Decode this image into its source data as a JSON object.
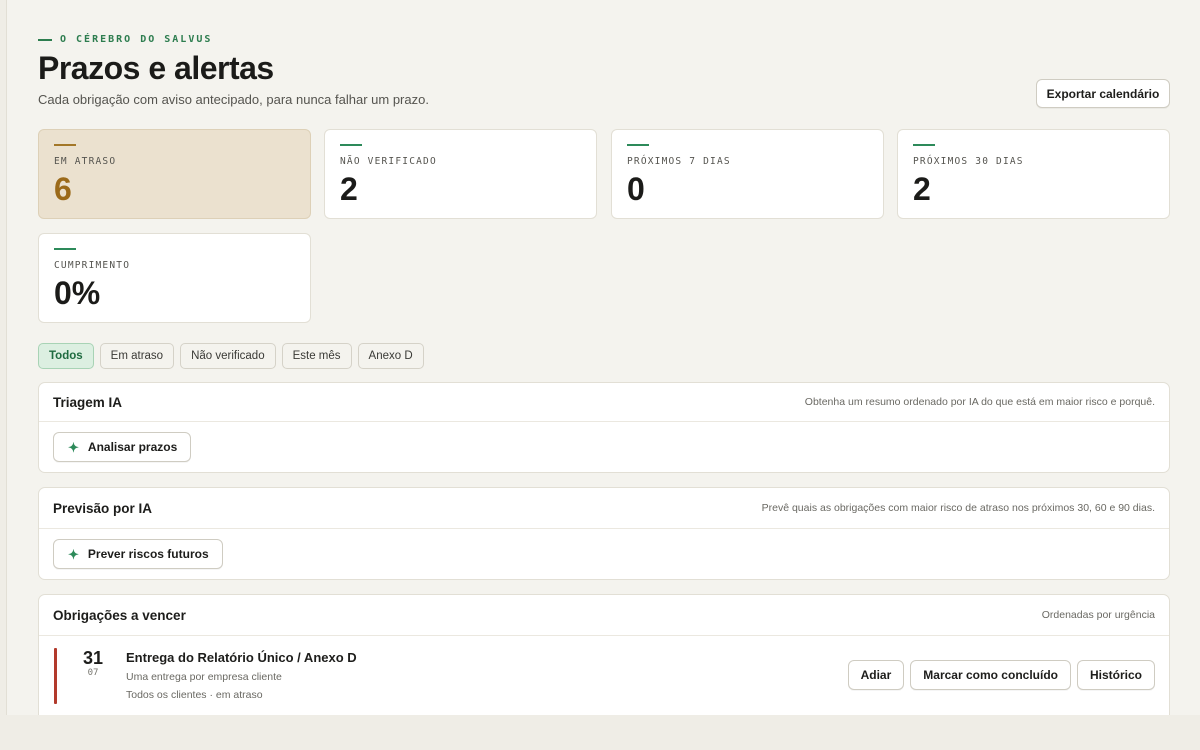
{
  "header": {
    "eyebrow": "O CÉREBRO DO SALVUS",
    "title": "Prazos e alertas",
    "subtitle": "Cada obrigação com aviso antecipado, para nunca falhar um prazo.",
    "export_label": "Exportar calendário"
  },
  "stats": [
    {
      "label": "EM ATRASO",
      "value": "6"
    },
    {
      "label": "NÃO VERIFICADO",
      "value": "2"
    },
    {
      "label": "PRÓXIMOS 7 DIAS",
      "value": "0"
    },
    {
      "label": "PRÓXIMOS 30 DIAS",
      "value": "2"
    },
    {
      "label": "CUMPRIMENTO",
      "value": "0%"
    }
  ],
  "filters": [
    "Todos",
    "Em atraso",
    "Não verificado",
    "Este mês",
    "Anexo D"
  ],
  "triage": {
    "title": "Triagem IA",
    "desc": "Obtenha um resumo ordenado por IA do que está em maior risco e porquê.",
    "button": "Analisar prazos"
  },
  "forecast": {
    "title": "Previsão por IA",
    "desc": "Prevê quais as obrigações com maior risco de atraso nos próximos 30, 60 e 90 dias.",
    "button": "Prever riscos futuros"
  },
  "obligations": {
    "title": "Obrigações a vencer",
    "desc": "Ordenadas por urgência",
    "items": [
      {
        "day": "31",
        "month": "07",
        "title": "Entrega do Relatório Único / Anexo D",
        "subtitle": "Uma entrega por empresa cliente",
        "meta": "Todos os clientes · em atraso",
        "actions": {
          "postpone": "Adiar",
          "complete": "Marcar como concluído",
          "history": "Histórico"
        }
      }
    ]
  },
  "colors": {
    "accent_green": "#2d8a5a",
    "alert_amber": "#9b6a1a",
    "overdue_red": "#b23a2c"
  }
}
